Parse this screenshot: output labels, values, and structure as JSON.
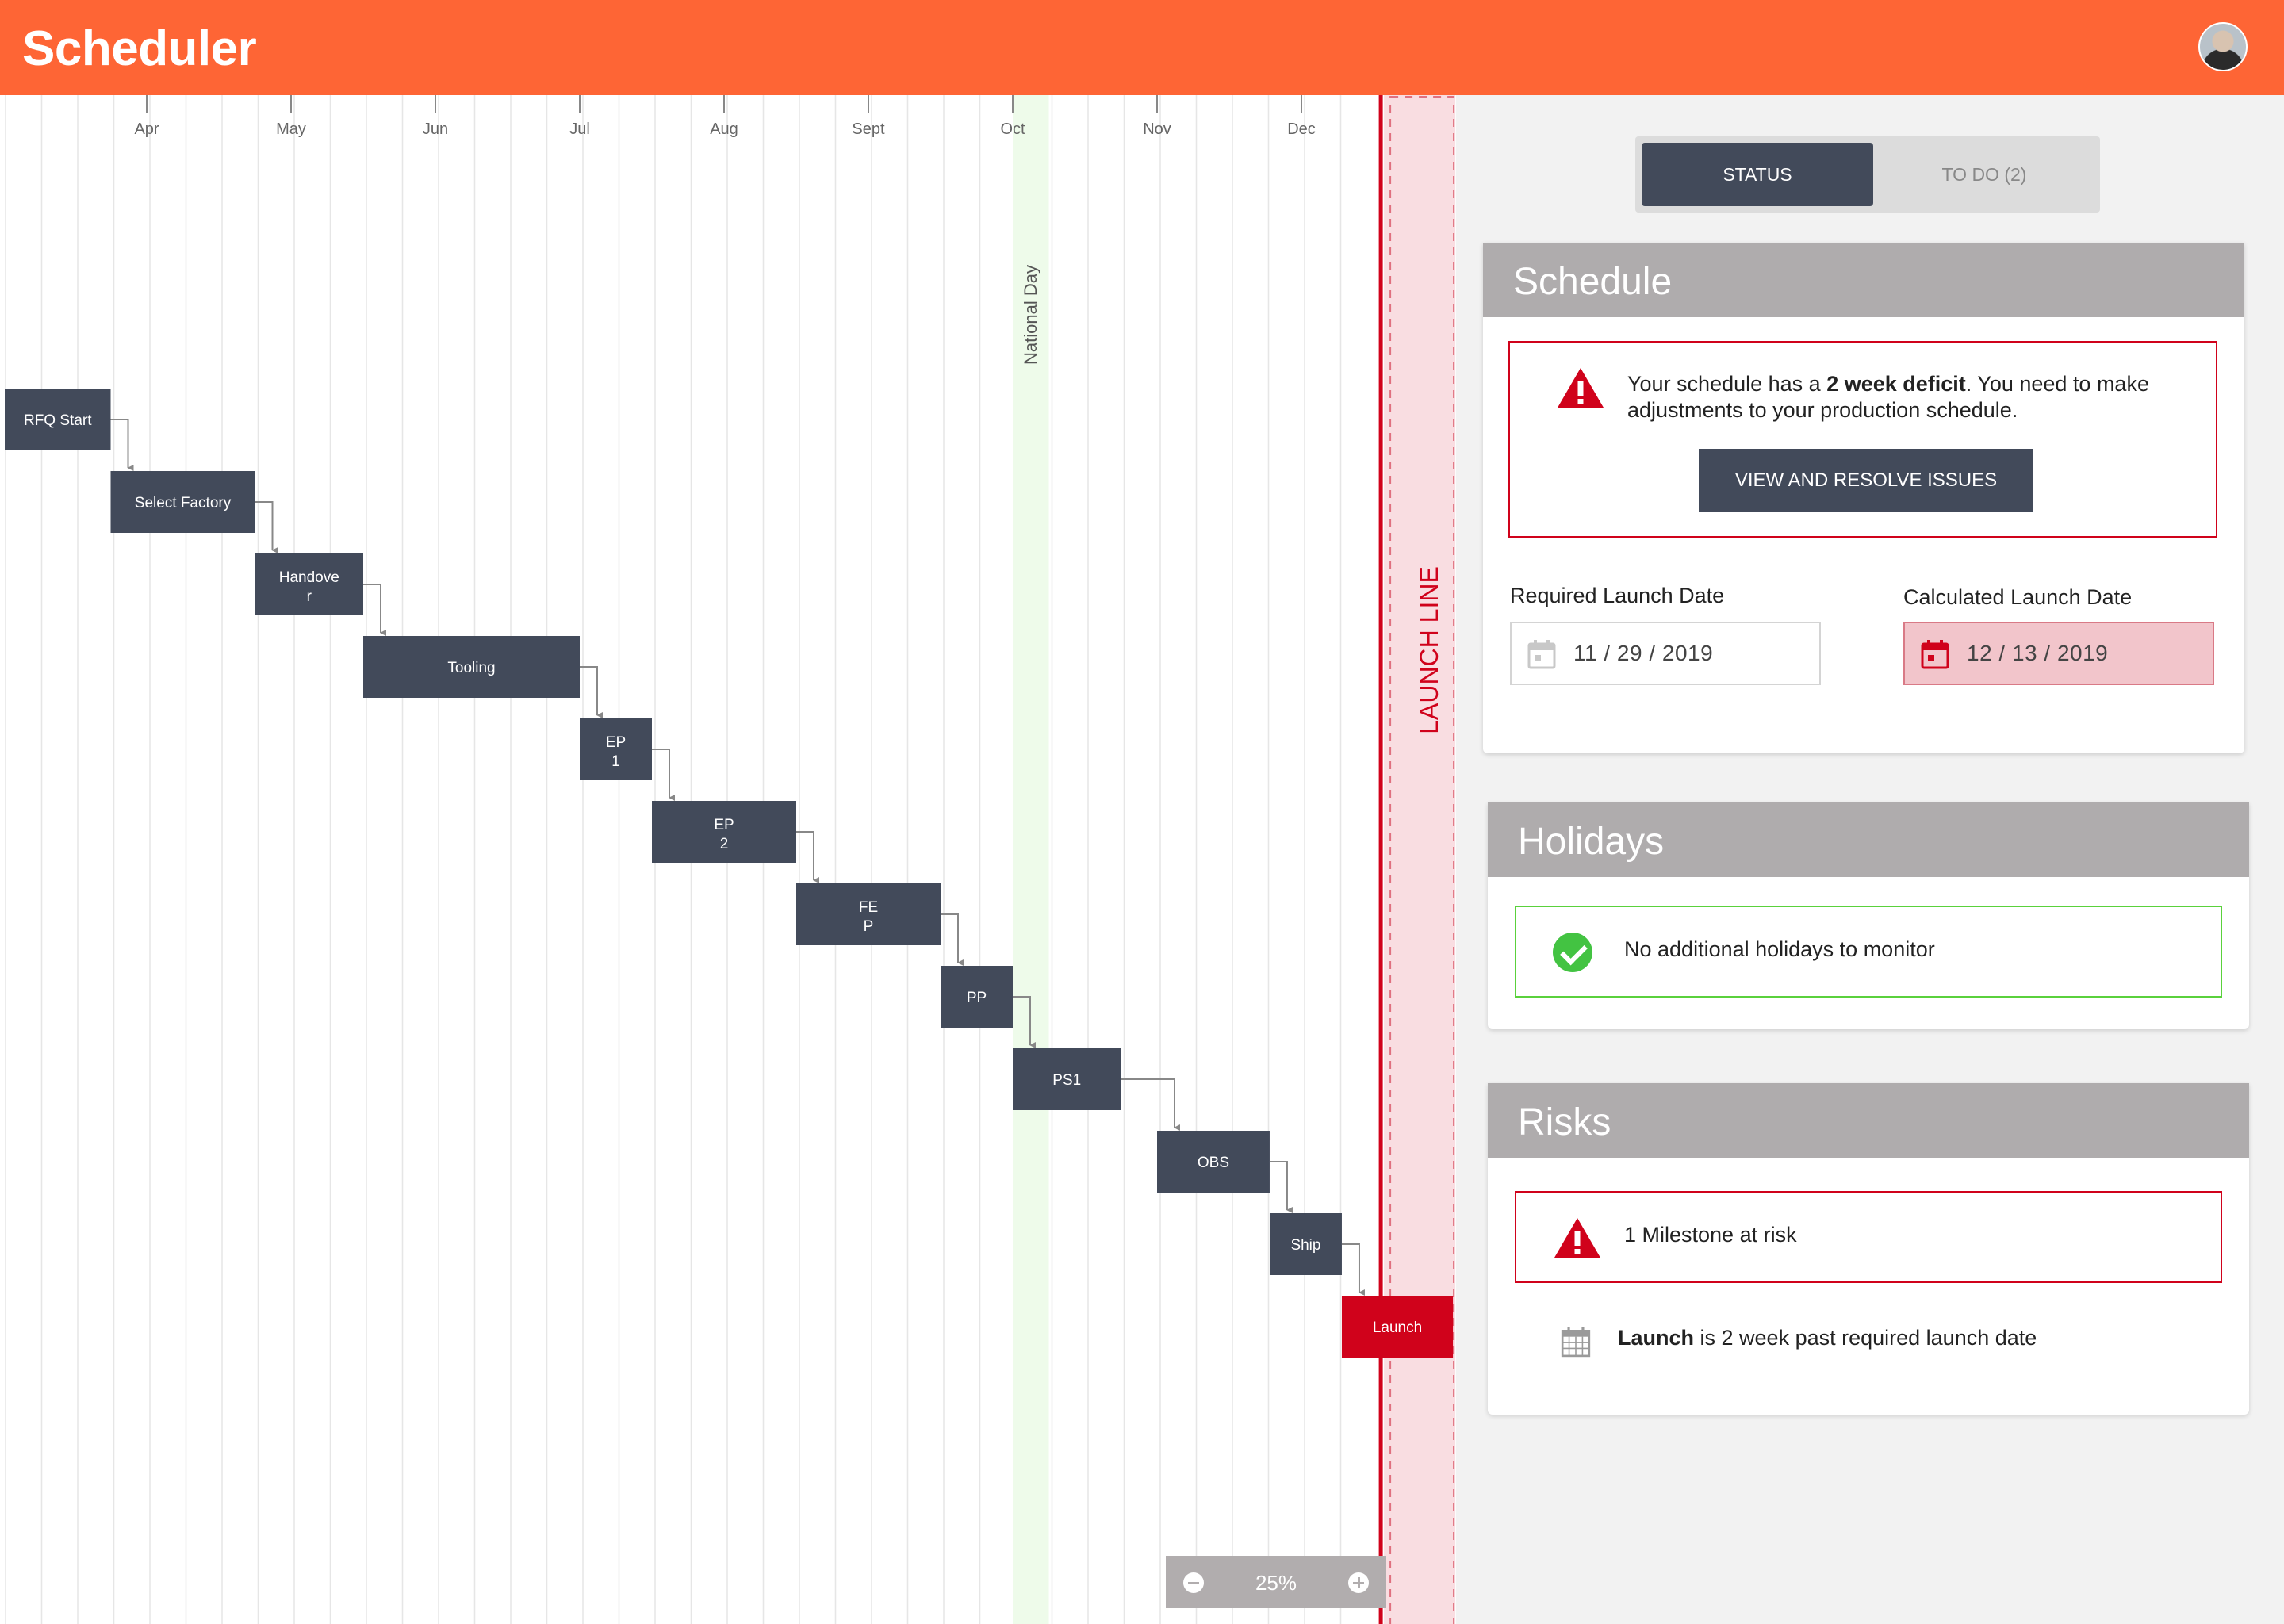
{
  "app": {
    "title": "Scheduler"
  },
  "timeline": {
    "months": [
      "Apr",
      "May",
      "Jun",
      "Jul",
      "Aug",
      "Sept",
      "Oct",
      "Nov",
      "Dec"
    ],
    "holiday": {
      "label": "National Day",
      "month_index": 6,
      "duration_months": 0.25
    },
    "launch_line": {
      "label": "LAUNCH LINE",
      "month_position": 8.55
    },
    "zoom": "25%"
  },
  "tasks": [
    {
      "label": "RFQ Start",
      "start": -1.0,
      "end": -0.25,
      "status": "ok"
    },
    {
      "label": "Select Factory",
      "start": -0.25,
      "end": 0.75,
      "status": "ok"
    },
    {
      "label": "Handove\nr",
      "start": 0.75,
      "end": 1.5,
      "status": "ok"
    },
    {
      "label": "Tooling",
      "start": 1.5,
      "end": 3.0,
      "status": "ok"
    },
    {
      "label": "EP\n1",
      "start": 3.0,
      "end": 3.5,
      "status": "ok"
    },
    {
      "label": "EP\n2",
      "start": 3.5,
      "end": 4.5,
      "status": "ok"
    },
    {
      "label": "FE\nP",
      "start": 4.5,
      "end": 5.5,
      "status": "ok"
    },
    {
      "label": "PP",
      "start": 5.5,
      "end": 6.0,
      "status": "ok"
    },
    {
      "label": "PS1",
      "start": 6.0,
      "end": 6.75,
      "status": "ok"
    },
    {
      "label": "OBS",
      "start": 7.0,
      "end": 7.78,
      "status": "ok"
    },
    {
      "label": "Ship",
      "start": 7.78,
      "end": 8.28,
      "status": "ok"
    },
    {
      "label": "Launch",
      "start": 8.28,
      "end": 9.05,
      "status": "risk"
    }
  ],
  "tabs": {
    "status": "STATUS",
    "todo": "TO DO (2)"
  },
  "schedule": {
    "title": "Schedule",
    "alert_prefix": "Your schedule has a ",
    "alert_bold": "2 week deficit",
    "alert_suffix": ". You need to make adjustments to your production schedule.",
    "button": "VIEW AND RESOLVE ISSUES",
    "required_label": "Required Launch Date",
    "required_value": "11 / 29 / 2019",
    "calculated_label": "Calculated Launch Date",
    "calculated_value": "12 / 13 / 2019"
  },
  "holidays": {
    "title": "Holidays",
    "message": "No additional holidays to monitor"
  },
  "risks": {
    "title": "Risks",
    "summary": "1 Milestone at risk",
    "detail_bold": "Launch",
    "detail_rest": " is 2 week past required launch date"
  },
  "colors": {
    "accent": "#fe6535",
    "task": "#424a5a",
    "risk": "#d0021b",
    "ok": "#43c342",
    "holiday": "#eefbea"
  }
}
